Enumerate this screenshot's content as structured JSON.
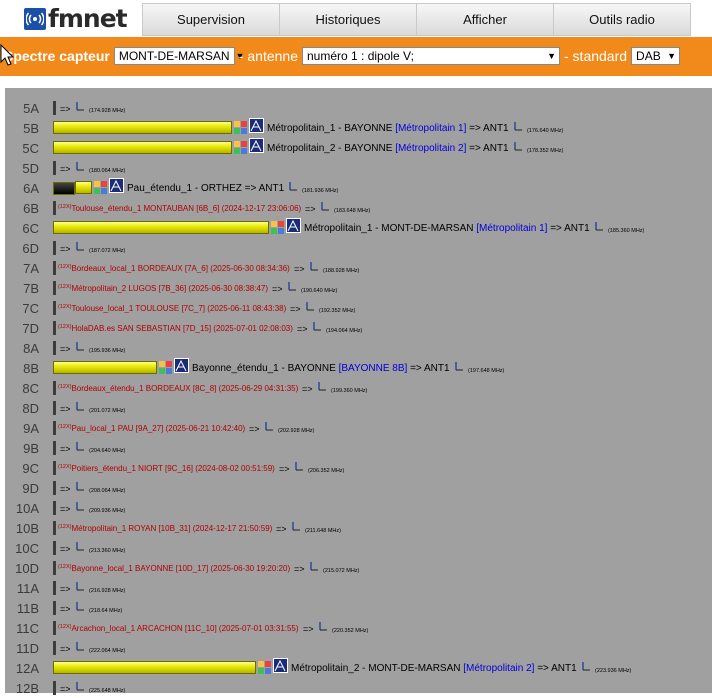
{
  "nav": {
    "logo_text": "fmnet",
    "tabs": [
      {
        "label": "Supervision"
      },
      {
        "label": "Historiques"
      },
      {
        "label": "Afficher"
      },
      {
        "label": "Outils radio"
      }
    ]
  },
  "toolbar": {
    "label_spectre": "Spectre capteur",
    "capteur_value": "MONT-DE-MARSAN",
    "label_antenne": "- antenne",
    "antenne_value": "numéro 1 : dipole V;",
    "label_standard": "- standard",
    "standard_value": "DAB"
  },
  "colors": {
    "orange": "#f18a1b",
    "panel": "#a0a0a0",
    "service_link": "#0000d8",
    "history": "#b00000"
  },
  "rows": [
    {
      "ch": "5A",
      "freq": "(174.928 MHz)"
    },
    {
      "ch": "5B",
      "level": 0.83,
      "name": "Métropolitain_1 - BAYONNE",
      "service": "[Métropolitain 1]",
      "ant": "=> ANT1",
      "freq": "(176.640 MHz)"
    },
    {
      "ch": "5C",
      "level": 0.83,
      "name": "Métropolitain_2 - BAYONNE",
      "service": "[Métropolitain 2]",
      "ant": "=> ANT1",
      "freq": "(178.352 MHz)"
    },
    {
      "ch": "5D",
      "freq": "(180.064 MHz)"
    },
    {
      "ch": "6A",
      "level": 0.08,
      "dark_level": 0.1,
      "name": "Pau_étendu_1 - ORTHEZ",
      "ant": "=> ANT1",
      "freq": "(181.936 MHz)"
    },
    {
      "ch": "6B",
      "hist": "Toulouse_étendu_1 MONTAUBAN [6B_6] (2024-12-17 23:06:06)",
      "freq": "(183.648 MHz)"
    },
    {
      "ch": "6C",
      "level": 1.0,
      "name": "Métropolitain_1 - MONT-DE-MARSAN",
      "service": "[Métropolitain 1]",
      "ant": "=> ANT1",
      "freq": "(185.360 MHz)"
    },
    {
      "ch": "6D",
      "freq": "(187.072 MHz)"
    },
    {
      "ch": "7A",
      "hist": "Bordeaux_local_1 BORDEAUX [7A_6] (2025-06-30 08:34:36)",
      "freq": "(188.928 MHz)"
    },
    {
      "ch": "7B",
      "hist": "Métropolitain_2 LUGOS [7B_36] (2025-06-30 08:38:47)",
      "freq": "(190.640 MHz)"
    },
    {
      "ch": "7C",
      "hist": "Toulouse_local_1 TOULOUSE [7C_7] (2025-06-11 08:43:38)",
      "freq": "(192.352 MHz)"
    },
    {
      "ch": "7D",
      "hist": "HolaDAB.es SAN SEBASTIAN [7D_15] (2025-07-01 02:08:03)",
      "freq": "(194.064 MHz)"
    },
    {
      "ch": "8A",
      "freq": "(195.936 MHz)"
    },
    {
      "ch": "8B",
      "level": 0.48,
      "name": "Bayonne_étendu_1 - BAYONNE",
      "service": "[BAYONNE 8B]",
      "ant": "=> ANT1",
      "freq": "(197.648 MHz)"
    },
    {
      "ch": "8C",
      "hist": "Bordeaux_étendu_1 BORDEAUX [8C_8] (2025-06-29 04:31:35)",
      "freq": "(199.360 MHz)"
    },
    {
      "ch": "8D",
      "freq": "(201.072 MHz)"
    },
    {
      "ch": "9A",
      "hist": "Pau_local_1 PAU [9A_27] (2025-06-21 10:42:40)",
      "freq": "(202.928 MHz)"
    },
    {
      "ch": "9B",
      "freq": "(204.640 MHz)"
    },
    {
      "ch": "9C",
      "hist": "Poitiers_étendu_1 NIORT [9C_16] (2024-08-02 00:51:59)",
      "freq": "(206.352 MHz)"
    },
    {
      "ch": "9D",
      "freq": "(208.064 MHz)"
    },
    {
      "ch": "10A",
      "freq": "(209.936 MHz)"
    },
    {
      "ch": "10B",
      "hist": "Métropolitain_1 ROYAN [10B_31] (2024-12-17 21:50:59)",
      "freq": "(211.648 MHz)"
    },
    {
      "ch": "10C",
      "freq": "(213.360 MHz)"
    },
    {
      "ch": "10D",
      "hist": "Bayonne_local_1 BAYONNE [10D_17] (2025-06-30 19:20:20)",
      "freq": "(215.072 MHz)"
    },
    {
      "ch": "11A",
      "freq": "(216.928 MHz)"
    },
    {
      "ch": "11B",
      "freq": "(218.64 MHz)"
    },
    {
      "ch": "11C",
      "hist": "Arcachon_local_1 ARCACHON [11C_10] (2025-07-01 03:31:55)",
      "freq": "(220.352 MHz)"
    },
    {
      "ch": "11D",
      "freq": "(222.064 MHz)"
    },
    {
      "ch": "12A",
      "level": 0.94,
      "name": "Métropolitain_2 - MONT-DE-MARSAN",
      "service": "[Métropolitain 2]",
      "ant": "=> ANT1",
      "freq": "(223.936 MHz)"
    },
    {
      "ch": "12B",
      "freq": "(225.648 MHz)"
    }
  ],
  "common": {
    "arrow": "=>",
    "max_marker": "(12X)",
    "icon": "antenna-icon"
  }
}
